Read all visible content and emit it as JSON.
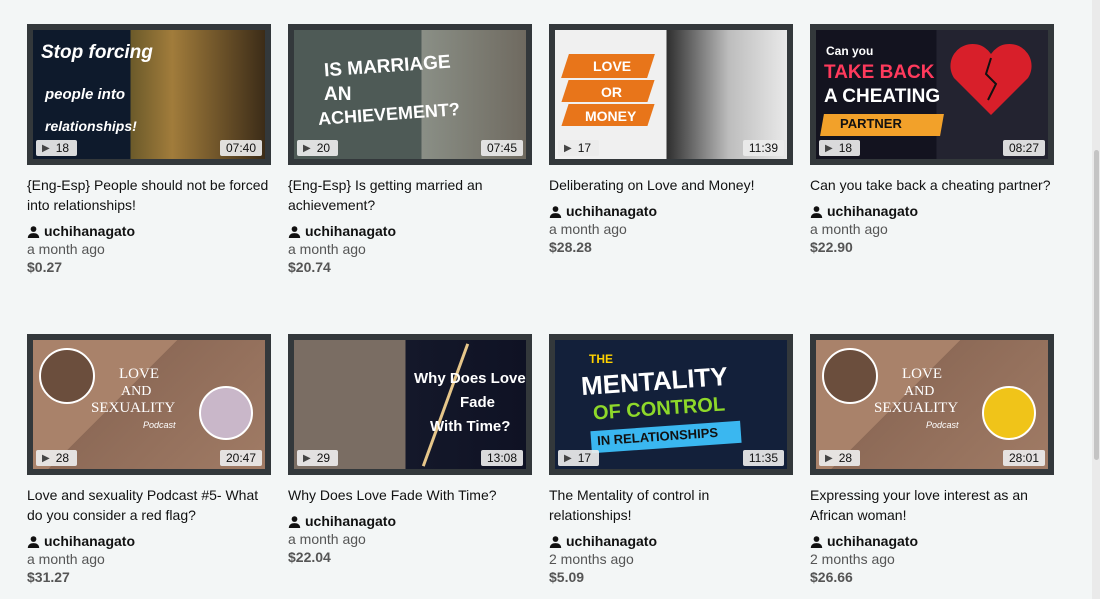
{
  "videos": [
    {
      "title": "{Eng-Esp} People should not be forced into relationships!",
      "author": "uchihanagato",
      "ago": "a month ago",
      "price": "$0.27",
      "views": "18",
      "duration": "07:40",
      "thumb_text": "Stop forcing people into relationships!"
    },
    {
      "title": "{Eng-Esp} Is getting married an achievement?",
      "author": "uchihanagato",
      "ago": "a month ago",
      "price": "$20.74",
      "views": "20",
      "duration": "07:45",
      "thumb_text": "IS MARRIAGE AN ACHIEVEMENT?"
    },
    {
      "title": "Deliberating on Love and Money!",
      "author": "uchihanagato",
      "ago": "a month ago",
      "price": "$28.28",
      "views": "17",
      "duration": "11:39",
      "thumb_text": "LOVE OR MONEY"
    },
    {
      "title": "Can you take back a cheating partner?",
      "author": "uchihanagato",
      "ago": "a month ago",
      "price": "$22.90",
      "views": "18",
      "duration": "08:27",
      "thumb_text": "Can you TAKE BACK A CHEATING PARTNER"
    },
    {
      "title": "Love and sexuality Podcast #5- What do you consider a red flag?",
      "author": "uchihanagato",
      "ago": "a month ago",
      "price": "$31.27",
      "views": "28",
      "duration": "20:47",
      "thumb_text": "LOVE AND SEXUALITY Podcast"
    },
    {
      "title": "Why Does Love Fade With Time?",
      "author": "uchihanagato",
      "ago": "a month ago",
      "price": "$22.04",
      "views": "29",
      "duration": "13:08",
      "thumb_text": "Why Does Love Fade With Time?"
    },
    {
      "title": "The Mentality of control in relationships!",
      "author": "uchihanagato",
      "ago": "2 months ago",
      "price": "$5.09",
      "views": "17",
      "duration": "11:35",
      "thumb_text": "THE MENTALITY OF CONTROL IN RELATIONSHIPS"
    },
    {
      "title": "Expressing your love interest as an African woman!",
      "author": "uchihanagato",
      "ago": "2 months ago",
      "price": "$26.66",
      "views": "28",
      "duration": "28:01",
      "thumb_text": "LOVE AND SEXUALITY Podcast"
    }
  ],
  "thumb_art": {
    "c0": "Stop forcing",
    "c0b": "people into",
    "c0c": "relationships!",
    "c1": "IS MARRIAGE",
    "c1b": "AN",
    "c1c": "ACHIEVEMENT?",
    "c2": "LOVE",
    "c2b": "OR",
    "c2c": "MONEY",
    "c3": "Can you",
    "c3b": "TAKE BACK",
    "c3c": "A CHEATING",
    "c3d": "PARTNER",
    "c4": "LOVE",
    "c4b": "AND",
    "c4c": "SEXUALITY",
    "c4d": "Podcast",
    "c5": "Why Does Love",
    "c5b": "Fade",
    "c5c": "With Time?",
    "c6": "THE",
    "c6b": "MENTALITY",
    "c6c": "OF CONTROL",
    "c6d": "IN RELATIONSHIPS",
    "c7": "LOVE",
    "c7b": "AND",
    "c7c": "SEXUALITY",
    "c7d": "Podcast"
  }
}
